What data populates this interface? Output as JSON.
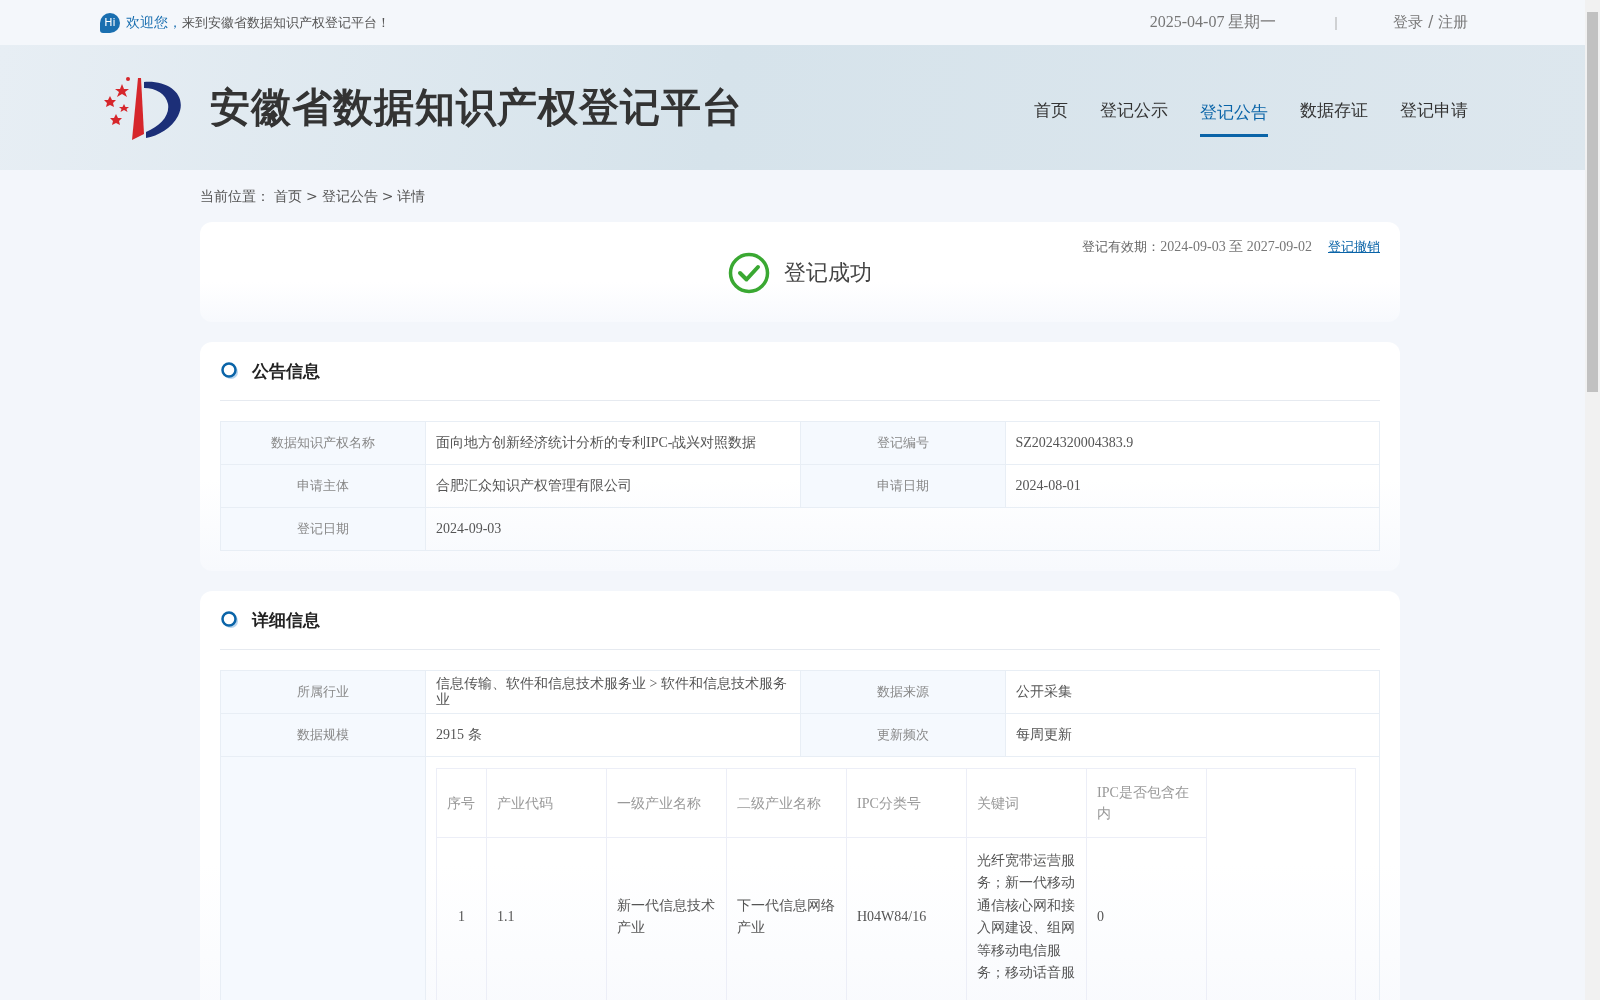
{
  "top_bar": {
    "badge": "Hi",
    "welcome": "欢迎您，",
    "message": "来到安徽省数据知识产权登记平台！",
    "date": "2025-04-07 星期一",
    "separator": "|",
    "account_link": "登录 / 注册"
  },
  "header": {
    "site_title": "安徽省数据知识产权登记平台",
    "nav": [
      {
        "label": "首页",
        "selected": false
      },
      {
        "label": "登记公示",
        "selected": false
      },
      {
        "label": "登记公告",
        "selected": true
      },
      {
        "label": "数据存证",
        "selected": false
      },
      {
        "label": "登记申请",
        "selected": false
      }
    ]
  },
  "breadcrumb": {
    "prefix": "当前位置：",
    "separator": ">",
    "items": [
      "首页",
      "登记公告",
      "详情"
    ]
  },
  "status": {
    "result": "登记成功",
    "validity_label": "登记有效期：",
    "validity": "2024-09-03 至 2027-09-02",
    "revoke_link": "登记撤销"
  },
  "sections": [
    {
      "title": "公告信息",
      "rows": [
        [
          {
            "label": "数据知识产权名称",
            "value": "面向地方创新经济统计分析的专利IPC-战兴对照数据"
          },
          {
            "label": "登记编号",
            "value": "SZ2024320004383.9"
          }
        ],
        [
          {
            "label": "申请主体",
            "value": "合肥汇众知识产权管理有限公司"
          },
          {
            "label": "申请日期",
            "value": "2024-08-01"
          }
        ],
        [
          {
            "label": "登记日期",
            "value": "2024-09-03"
          }
        ]
      ]
    },
    {
      "title": "详细信息",
      "rows": [
        [
          {
            "label": "所属行业",
            "value": "信息传输、软件和信息技术服务业 > 软件和信息技术服务业"
          },
          {
            "label": "数据来源",
            "value": "公开采集"
          }
        ],
        [
          {
            "label": "数据规模",
            "value": "2915 条"
          },
          {
            "label": "更新频次",
            "value": "每周更新"
          }
        ]
      ],
      "ipc_table": {
        "columns": [
          "序号",
          "产业代码",
          "一级产业名称",
          "二级产业名称",
          "IPC分类号",
          "关键词",
          "IPC是否包含在内"
        ],
        "rows": [
          [
            "1",
            "1.1",
            "新一代信息技术产业",
            "下一代信息网络产业",
            "H04W84/16",
            "光纤宽带运营服务；新一代移动通信核心网和接入网建设、组网等移动电信服务；移动话音服",
            "0"
          ]
        ]
      }
    }
  ]
}
